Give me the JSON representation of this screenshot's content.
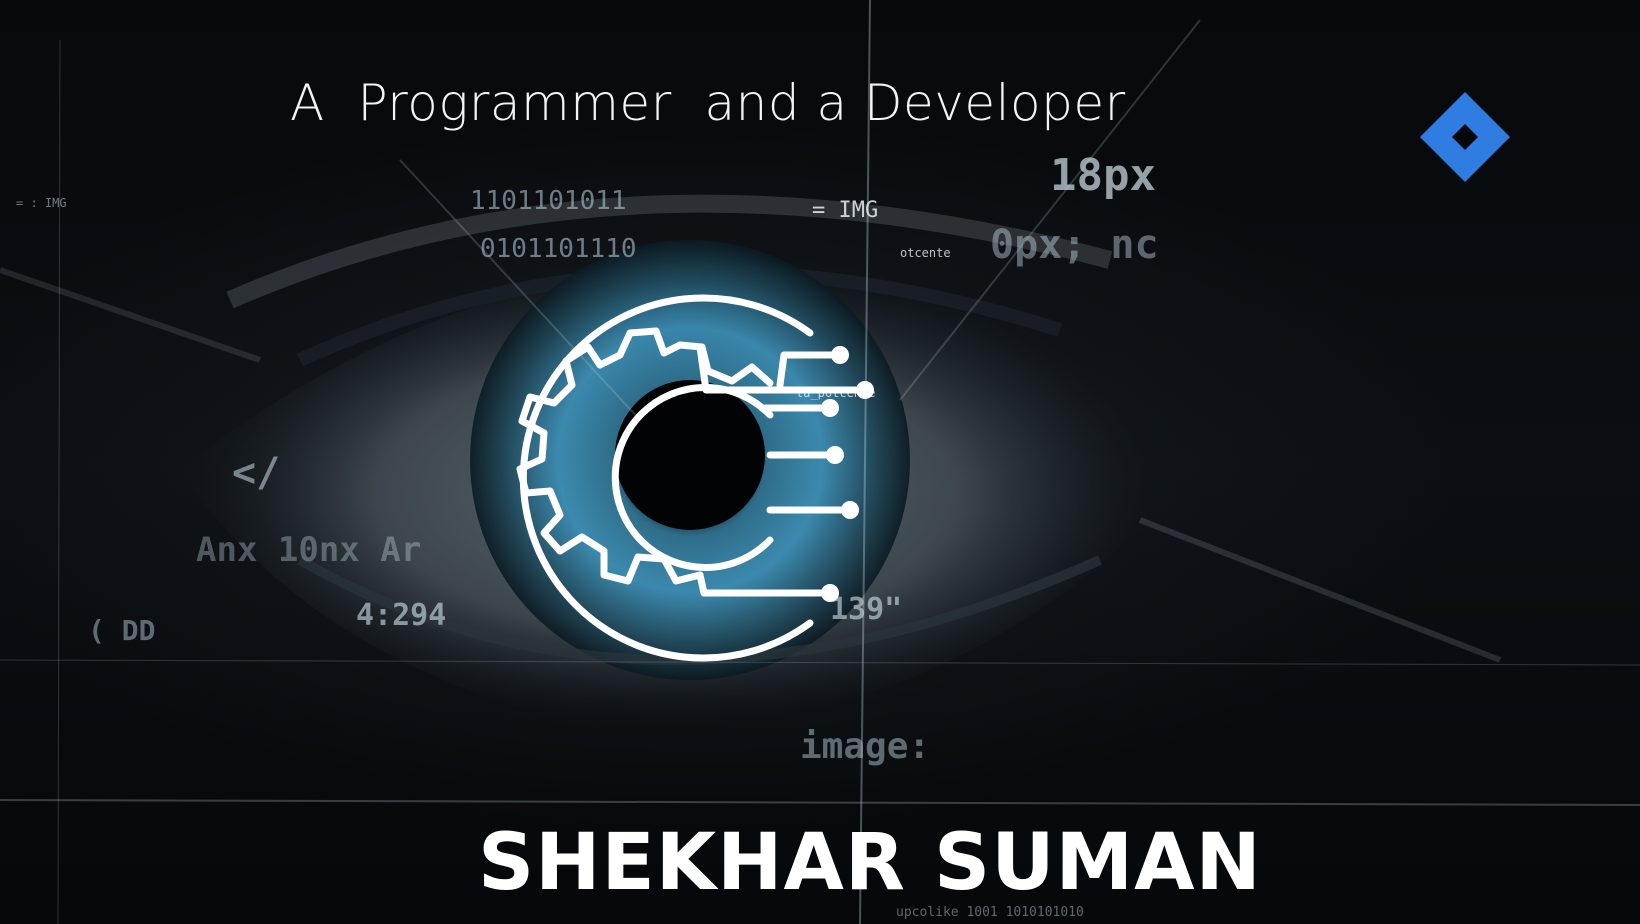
{
  "tagline": "A  Programmer  and a Developer",
  "name": "SHEKHAR SUMAN",
  "logo": {
    "icon": "diamond-logo-icon",
    "color": "#2f7de1"
  },
  "emblem": {
    "icon": "gear-eye-circuit-icon",
    "color": "#ffffff"
  },
  "background": {
    "description_icon": "digital-eye-icon",
    "accent": "#3a8fb7"
  },
  "code_fragments": {
    "f1": "= : IMG",
    "f2": "1101101011",
    "f3": "0101101110",
    "f4": "= IMG",
    "f5": "18px",
    "f6": "otcente",
    "f7": "0px; nc",
    "f8": "</",
    "f9": "Anx 10nx Ar",
    "f10": "4:294",
    "f11": "ta_potcente",
    "f12": "139\"",
    "f13": "image:",
    "f14": "upcolike 1001 1010101010",
    "f15": "( DD"
  }
}
